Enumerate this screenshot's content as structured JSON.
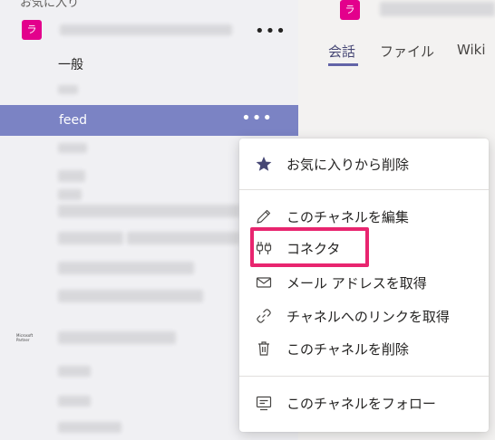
{
  "sidebar": {
    "favorites_header": "お気に入り",
    "team_avatar": "ラ",
    "team_more": "•••",
    "channels": {
      "general": "一般",
      "feed": "feed"
    },
    "feed_more": "•••",
    "partner_logo": "Microsoft Partner"
  },
  "header": {
    "avatar": "ラ",
    "tabs": [
      {
        "label": "会話",
        "active": true
      },
      {
        "label": "ファイル"
      },
      {
        "label": "Wiki"
      }
    ]
  },
  "context_menu": {
    "items": [
      {
        "label": "お気に入りから削除",
        "icon": "star-icon"
      },
      {
        "label": "このチャネルを編集",
        "icon": "pencil-icon"
      },
      {
        "label": "コネクタ",
        "icon": "connector-plug-icon",
        "highlighted": true
      },
      {
        "label": "メール アドレスを取得",
        "icon": "envelope-icon"
      },
      {
        "label": "チャネルへのリンクを取得",
        "icon": "link-icon"
      },
      {
        "label": "このチャネルを削除",
        "icon": "trash-icon"
      },
      {
        "label": "このチャネルをフォロー",
        "icon": "follow-channel-icon"
      }
    ]
  },
  "colors": {
    "selected_channel_bg": "#7b83c4",
    "team_avatar_bg": "#e3008c",
    "highlight_border": "#e8256f",
    "accent": "#6264a7"
  }
}
